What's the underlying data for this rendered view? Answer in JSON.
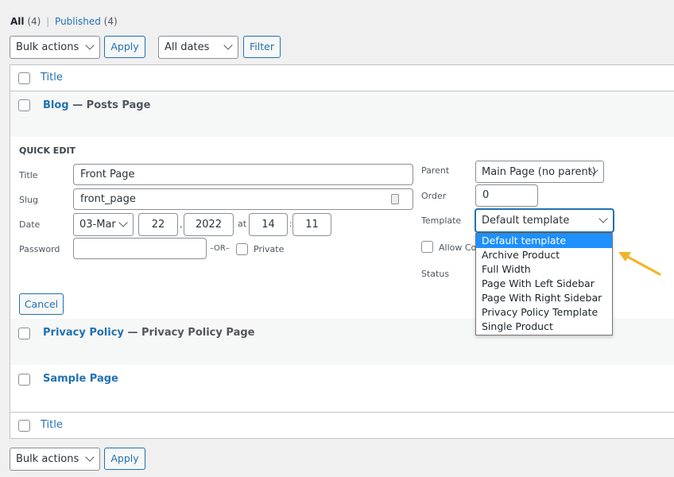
{
  "filters": {
    "all_label": "All",
    "all_count": "(4)",
    "sep": "|",
    "published_label": "Published",
    "published_count": "(4)"
  },
  "top_actions": {
    "bulk": "Bulk actions",
    "apply": "Apply",
    "dates": "All dates",
    "filter": "Filter"
  },
  "table": {
    "header_title": "Title",
    "footer_title": "Title",
    "rows": [
      {
        "title": "Blog",
        "state": "— Posts Page"
      },
      {
        "title": "Privacy Policy",
        "state": "— Privacy Policy Page"
      },
      {
        "title": "Sample Page",
        "state": ""
      }
    ]
  },
  "quick_edit": {
    "heading": "QUICK EDIT",
    "title_label": "Title",
    "title_value": "Front Page",
    "slug_label": "Slug",
    "slug_value": "front_page",
    "date_label": "Date",
    "month": "03-Mar",
    "day": "22",
    "comma": ",",
    "year": "2022",
    "at": "at",
    "hour": "14",
    "colon": ":",
    "minute": "11",
    "password_label": "Password",
    "password_value": "",
    "or": "–OR–",
    "private_label": "Private",
    "parent_label": "Parent",
    "parent_value": "Main Page (no parent)",
    "order_label": "Order",
    "order_value": "0",
    "template_label": "Template",
    "template_value": "Default template",
    "allow_comments_label": "Allow Co",
    "status_label": "Status",
    "cancel": "Cancel",
    "template_options": [
      "Default template",
      "Archive Product",
      "Full Width",
      "Page With Left Sidebar",
      "Page With Right Sidebar",
      "Privacy Policy Template",
      "Single Product"
    ],
    "highlighted_option": "Default template"
  },
  "bottom_actions": {
    "bulk": "Bulk actions",
    "apply": "Apply"
  },
  "colors": {
    "accent": "#2271b1",
    "highlight": "#1e90ff",
    "arrow": "#f0b429"
  }
}
